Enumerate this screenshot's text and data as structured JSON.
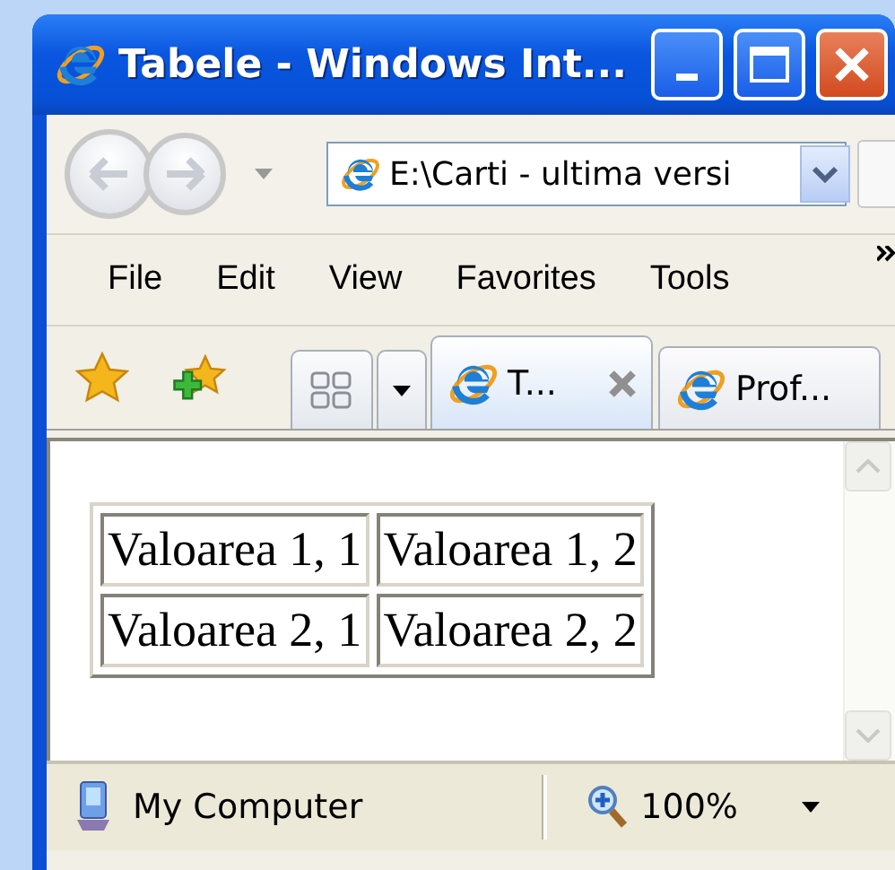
{
  "window": {
    "title": "Tabele - Windows Int..."
  },
  "address_bar": {
    "value": "E:\\Carti - ultima versi"
  },
  "menu": [
    {
      "label": "File"
    },
    {
      "label": "Edit"
    },
    {
      "label": "View"
    },
    {
      "label": "Favorites"
    },
    {
      "label": "Tools"
    }
  ],
  "tabs": [
    {
      "label": "T...",
      "selected": true
    },
    {
      "label": "Prof...",
      "selected": false
    }
  ],
  "table": {
    "rows": [
      [
        "Valoarea 1, 1",
        "Valoarea 1, 2"
      ],
      [
        "Valoarea 2, 1",
        "Valoarea 2, 2"
      ]
    ]
  },
  "status_bar": {
    "zone": "My Computer",
    "zoom": "100%"
  }
}
